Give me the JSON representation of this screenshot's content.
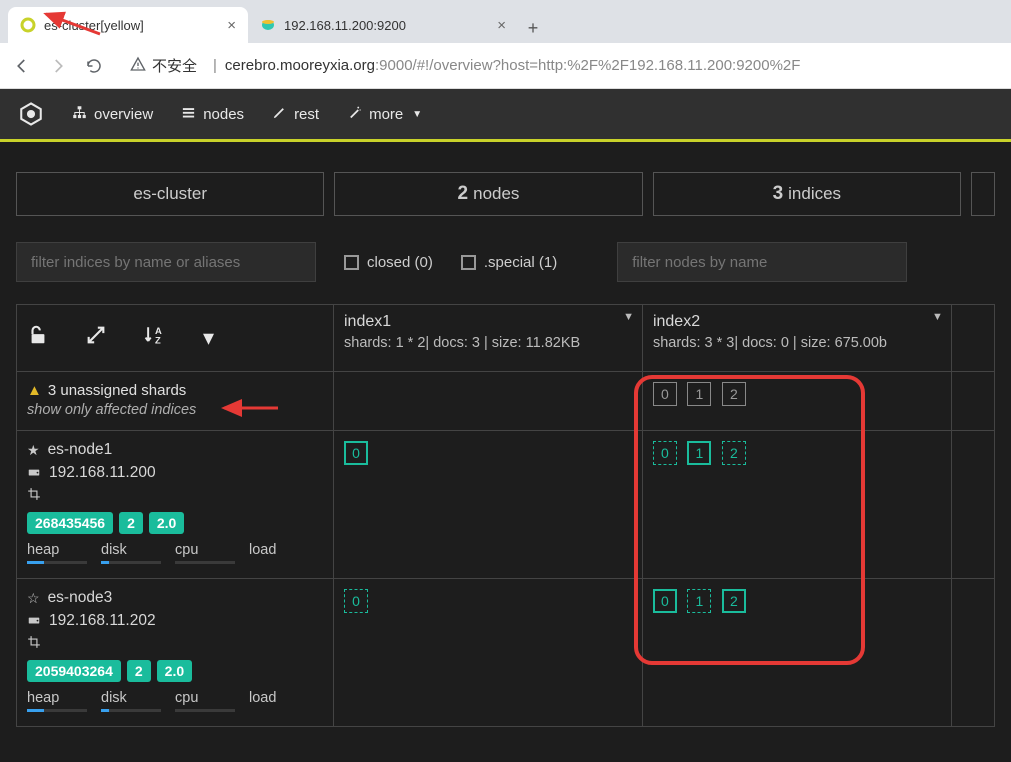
{
  "browser": {
    "tabs": [
      {
        "title": "es-cluster[yellow]",
        "favicon_color": "#c8d22a"
      },
      {
        "title": "192.168.11.200:9200",
        "favicon_color": "#30a0c0"
      }
    ],
    "url_insecure_label": "不安全",
    "url_host": "cerebro.mooreyxia.org",
    "url_port_path": ":9000/#!/overview?host=http:%2F%2F192.168.11.200:9200%2F"
  },
  "nav": {
    "items": [
      "overview",
      "nodes",
      "rest",
      "more"
    ]
  },
  "summary": {
    "cluster_name": "es-cluster",
    "nodes_count": "2",
    "nodes_label": "nodes",
    "indices_count": "3",
    "indices_label": "indices"
  },
  "filters": {
    "index_placeholder": "filter indices by name or aliases",
    "closed_label": "closed (0)",
    "special_label": ".special (1)",
    "node_placeholder": "filter nodes by name"
  },
  "indices": [
    {
      "name": "index1",
      "meta": "shards: 1 * 2| docs: 3 | size: 11.82KB"
    },
    {
      "name": "index2",
      "meta": "shards: 3 * 3| docs: 0 | size: 675.00b"
    }
  ],
  "warning": {
    "text": "3 unassigned shards",
    "sub": "show only affected indices"
  },
  "unassigned_shards": {
    "index2": [
      "0",
      "1",
      "2"
    ]
  },
  "nodes": [
    {
      "name": "es-node1",
      "host": "192.168.11.200",
      "starred": true,
      "badges": [
        "268435456",
        "2",
        "2.0"
      ],
      "stats": [
        "heap",
        "disk",
        "cpu",
        "load"
      ],
      "bars_pct": [
        28,
        14,
        0,
        0
      ],
      "shards": {
        "index1": [
          {
            "n": "0",
            "t": "primary"
          }
        ],
        "index2": [
          {
            "n": "0",
            "t": "replica"
          },
          {
            "n": "1",
            "t": "primary"
          },
          {
            "n": "2",
            "t": "replica"
          }
        ]
      }
    },
    {
      "name": "es-node3",
      "host": "192.168.11.202",
      "starred": false,
      "badges": [
        "2059403264",
        "2",
        "2.0"
      ],
      "stats": [
        "heap",
        "disk",
        "cpu",
        "load"
      ],
      "bars_pct": [
        28,
        14,
        0,
        0
      ],
      "shards": {
        "index1": [
          {
            "n": "0",
            "t": "replica"
          }
        ],
        "index2": [
          {
            "n": "0",
            "t": "primary"
          },
          {
            "n": "1",
            "t": "replica"
          },
          {
            "n": "2",
            "t": "primary"
          }
        ]
      }
    }
  ]
}
